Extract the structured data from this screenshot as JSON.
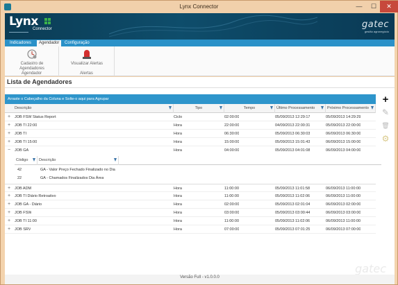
{
  "window": {
    "title": "Lynx Connector",
    "min": "—",
    "max": "☐",
    "close": "✕"
  },
  "banner": {
    "logo": "Lynx",
    "logo_sub": "Connector",
    "brand": "gatec",
    "brand_sub": "gestão agronegócio"
  },
  "ribbon": {
    "tabs": [
      "Indicadores",
      "Agendador",
      "Configuração"
    ],
    "active_tab": "Agendador",
    "groups": [
      {
        "button": "Cadastro de Agendadores",
        "button_l1": "Cadastro de",
        "button_l2": "Agendadores",
        "label": "Agendador",
        "icon": "clock-gear-icon"
      },
      {
        "button": "Visualizar Alertas",
        "label": "Alertas",
        "icon": "alarm-light-icon"
      }
    ]
  },
  "page": {
    "title": "Lista de Agendadores",
    "group_hint": "Arraste o Cabeçalho da Coluna e Solte-o aqui para Agrupar"
  },
  "grid": {
    "columns": [
      "Descrição",
      "Tipo",
      "Tempo",
      "Último Processamento",
      "Próximo Processamento"
    ],
    "rows": [
      {
        "exp": "+",
        "desc": "JOB FSW Status Report",
        "tipo": "Ciclo",
        "tempo": "02:00:00",
        "ultimo": "05/09/2013 12:29:17",
        "proximo": "05/09/2013 14:29:29"
      },
      {
        "exp": "+",
        "desc": "JOB TI 22:00",
        "tipo": "Hora",
        "tempo": "22:00:00",
        "ultimo": "04/09/2013 22:00:31",
        "proximo": "05/09/2013 22:00:00"
      },
      {
        "exp": "+",
        "desc": "JOB TI",
        "tipo": "Hora",
        "tempo": "06:30:00",
        "ultimo": "05/09/2013 06:30:03",
        "proximo": "06/09/2013 06:30:00"
      },
      {
        "exp": "+",
        "desc": "JOB TI 15:00",
        "tipo": "Hora",
        "tempo": "15:00:00",
        "ultimo": "05/09/2013 15:01:43",
        "proximo": "06/09/2013 15:00:00"
      },
      {
        "exp": "−",
        "desc": "JOB GA",
        "tipo": "Hora",
        "tempo": "04:00:00",
        "ultimo": "05/09/2013 04:01:08",
        "proximo": "06/09/2013 04:00:00"
      }
    ],
    "sub_columns": [
      "Código",
      "Descrição"
    ],
    "sub_rows": [
      {
        "codigo": "42",
        "desc": "GA - Valor Preço Fechado Finalizado no Dia"
      },
      {
        "codigo": "22",
        "desc": "GA - Chamados Finalizados Dia Área"
      }
    ],
    "rows2": [
      {
        "exp": "+",
        "desc": "JOB ADM",
        "tipo": "Hora",
        "tempo": "11:00:00",
        "ultimo": "05/09/2013 11:01:58",
        "proximo": "06/09/2013 11:00:00"
      },
      {
        "exp": "+",
        "desc": "JOB TI Diário Retroativo",
        "tipo": "Hora",
        "tempo": "11:00:00",
        "ultimo": "05/09/2013 11:02:06",
        "proximo": "06/09/2013 11:00:00"
      },
      {
        "exp": "+",
        "desc": "JOB GA - Diário",
        "tipo": "Hora",
        "tempo": "02:00:00",
        "ultimo": "05/09/2013 02:01:04",
        "proximo": "06/09/2013 02:00:00"
      },
      {
        "exp": "+",
        "desc": "JOB FSW",
        "tipo": "Hora",
        "tempo": "03:00:00",
        "ultimo": "05/09/2013 03:00:44",
        "proximo": "06/09/2013 03:00:00"
      },
      {
        "exp": "+",
        "desc": "JOB TI 11:00",
        "tipo": "Hora",
        "tempo": "11:00:00",
        "ultimo": "05/09/2013 11:02:06",
        "proximo": "06/09/2013 11:00:00"
      },
      {
        "exp": "+",
        "desc": "JOB SRV",
        "tipo": "Hora",
        "tempo": "07:00:00",
        "ultimo": "05/09/2013 07:01:25",
        "proximo": "06/09/2013 07:00:00"
      }
    ]
  },
  "side_actions": [
    {
      "icon": "plus-icon",
      "glyph": "+"
    },
    {
      "icon": "pencil-icon",
      "glyph": "✎"
    },
    {
      "icon": "trash-icon",
      "glyph": "🗑"
    },
    {
      "icon": "copy-settings-icon",
      "glyph": "⚙"
    }
  ],
  "footer": {
    "version": "Versão Full - v1.0.0.0"
  },
  "colors": {
    "accent": "#2e95cb",
    "banner": "#0e4d6b",
    "close": "#c7483b"
  }
}
